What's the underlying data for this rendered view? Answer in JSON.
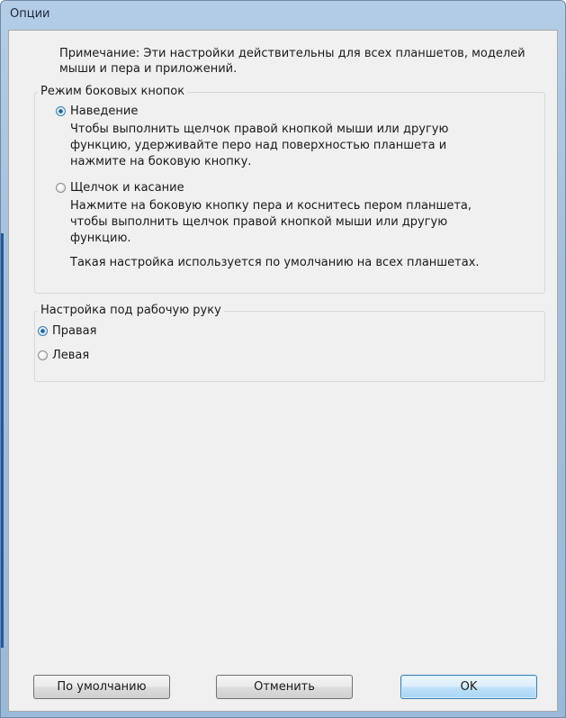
{
  "window": {
    "title": "Опции"
  },
  "note": "Примечание: Эти настройки действительны для всех планшетов, моделей мыши и пера и приложений.",
  "side_button_mode": {
    "label": "Режим боковых кнопок",
    "options": [
      {
        "label": "Наведение",
        "checked": true,
        "description": "Чтобы выполнить щелчок правой кнопкой мыши или другую функцию, удерживайте перо над поверхностью планшета и нажмите на боковую кнопку."
      },
      {
        "label": "Щелчок и касание",
        "checked": false,
        "description": "Нажмите на боковую кнопку пера и коснитесь пером планшета, чтобы выполнить щелчок правой кнопкой мыши или другую функцию."
      }
    ],
    "default_note": "Такая настройка используется по умолчанию на всех планшетах."
  },
  "handedness": {
    "label": "Настройка под рабочую руку",
    "options": [
      {
        "label": "Правая",
        "checked": true
      },
      {
        "label": "Левая",
        "checked": false
      }
    ]
  },
  "buttons": {
    "defaults": "По умолчанию",
    "cancel": "Отменить",
    "ok": "OK"
  },
  "colors": {
    "accent": "#3c7fb1",
    "dialog_background": "#f0f0f0",
    "titlebar": "#a2bfdc"
  }
}
